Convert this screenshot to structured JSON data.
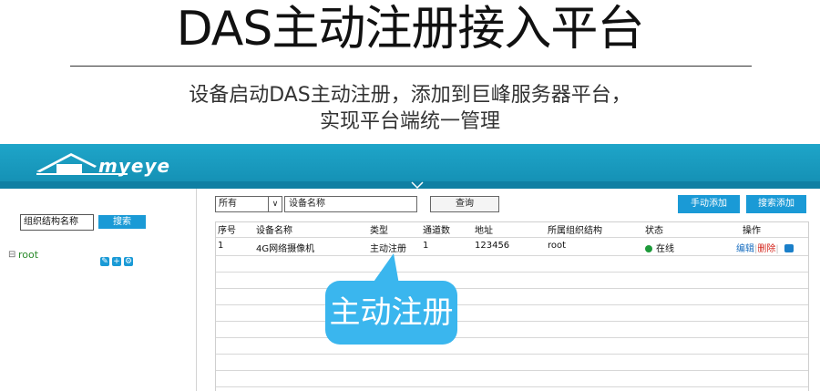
{
  "header": {
    "title": "DAS主动注册接入平台",
    "subtitle_line1": "设备启动DAS主动注册，添加到巨峰服务器平台，",
    "subtitle_line2": "实现平台端统一管理"
  },
  "app": {
    "logo_text": "myeye",
    "colors": {
      "banner": "#1ea5c9",
      "button": "#1a9ad6",
      "online": "#1d9a3a",
      "delete": "#d3251c",
      "callout": "#3ab6ee"
    }
  },
  "left_panel": {
    "org_input_value": "组织结构名称",
    "search_button": "搜索",
    "tree_root": "root"
  },
  "toolbar": {
    "filter_selected": "所有",
    "name_input_value": "设备名称",
    "query_button": "查询",
    "manual_add_button": "手动添加",
    "search_add_button": "搜索添加"
  },
  "table": {
    "columns": [
      "序号",
      "设备名称",
      "类型",
      "通道数",
      "地址",
      "所属组织结构",
      "状态",
      "操作"
    ],
    "rows": [
      {
        "index": "1",
        "device_name": "4G网络摄像机",
        "type": "主动注册",
        "channels": "1",
        "address": "123456",
        "org": "root",
        "status": "在线",
        "op_edit": "编辑",
        "op_sep": "|",
        "op_delete": "删除",
        "op_sep2": "|"
      }
    ]
  },
  "callout": {
    "text": "主动注册"
  }
}
